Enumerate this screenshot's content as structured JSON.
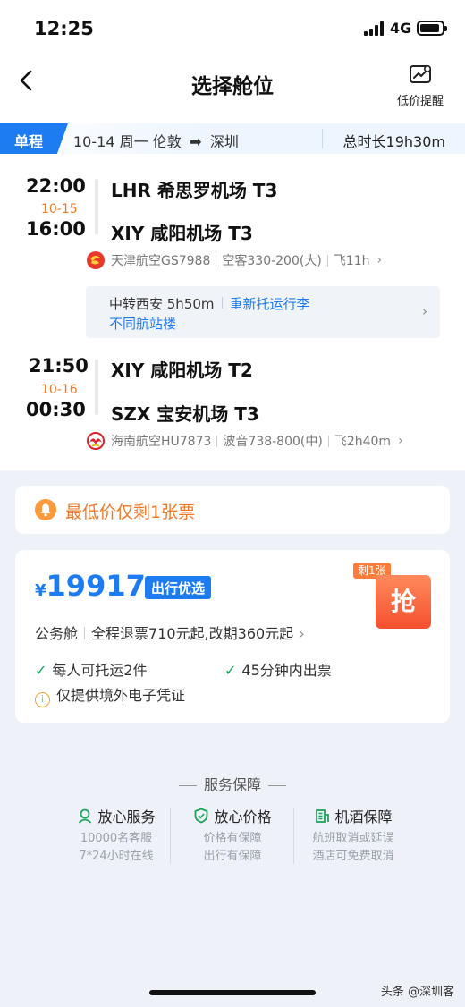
{
  "status_bar": {
    "time": "12:25",
    "network": "4G"
  },
  "nav": {
    "title": "选择舱位",
    "price_alert": "低价提醒"
  },
  "route": {
    "trip_type": "单程",
    "date": "10-14 周一",
    "from_city": "伦敦",
    "arrow": "➡",
    "to_city": "深圳",
    "total_duration": "总时长19h30m"
  },
  "segments": [
    {
      "dep_time": "22:00",
      "arr_date": "10-15",
      "arr_time": "16:00",
      "dep_airport": "LHR 希思罗机场 T3",
      "arr_airport": "XIY 咸阳机场 T3",
      "airline": "天津航空GS7988",
      "aircraft": "空客330-200(大)",
      "flight_time": "飞11h"
    },
    {
      "dep_time": "21:50",
      "arr_date": "10-16",
      "arr_time": "00:30",
      "dep_airport": "XIY 咸阳机场 T2",
      "arr_airport": "SZX 宝安机场 T3",
      "airline": "海南航空HU7873",
      "aircraft": "波音738-800(中)",
      "flight_time": "飞2h40m"
    }
  ],
  "transfer": {
    "info": "中转西安 5h50m",
    "recheck": "重新托运行李",
    "terminal": "不同航站楼"
  },
  "notice": {
    "text": "最低价仅剩1张票"
  },
  "fare": {
    "currency": "¥",
    "price": "19917",
    "badge": "出行优选",
    "tickets_left": "剩1张",
    "grab": "抢",
    "cabin": "公务舱",
    "policy": "全程退票710元起,改期360元起",
    "features": {
      "baggage": "每人可托运2件",
      "ticketing": "45分钟内出票",
      "voucher": "仅提供境外电子凭证"
    }
  },
  "service": {
    "title": "服务保障",
    "items": [
      {
        "title": "放心服务",
        "line1": "10000名客服",
        "line2": "7*24小时在线",
        "color": "#1ea35a"
      },
      {
        "title": "放心价格",
        "line1": "价格有保障",
        "line2": "出行有保障",
        "color": "#1ea35a"
      },
      {
        "title": "机酒保障",
        "line1": "航班取消或延误",
        "line2": "酒店可免费取消",
        "color": "#1ea35a"
      }
    ]
  },
  "watermark": "头条 @深圳客",
  "colors": {
    "accent": "#1d7cf2",
    "orange": "#f07a2a",
    "check": "#1ea35a"
  }
}
